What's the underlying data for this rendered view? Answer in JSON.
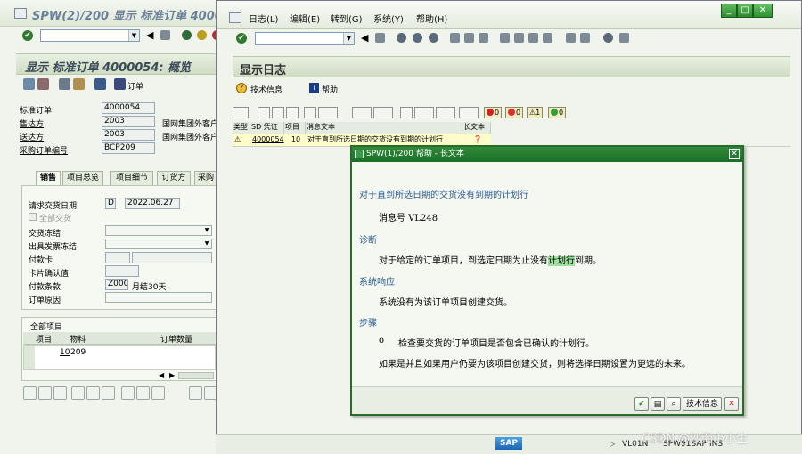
{
  "back_window": {
    "title": "SPW(2)/200 显示 标准订单 4000",
    "header_title": "显示 标准订单 4000054: 概览",
    "toolbar_order_label": "订单",
    "fields": [
      {
        "label": "标准订单",
        "value": "4000054",
        "extra": ""
      },
      {
        "label": "售达方",
        "value": "2003",
        "extra": "国网集团外客户"
      },
      {
        "label": "送达方",
        "value": "2003",
        "extra": "国网集团外客户"
      },
      {
        "label": "采购订单编号",
        "value": "BCP209",
        "extra": ""
      }
    ],
    "tabs": [
      "销售",
      "项目总览",
      "项目细节",
      "订货方",
      "采购"
    ],
    "sales": {
      "req_date_label": "请求交货日期",
      "req_date_unit": "D",
      "req_date_value": "2022.06.27",
      "complete_delivery_label": "全部交货",
      "delivery_block_label": "交货冻结",
      "billing_block_label": "出具发票冻结",
      "payment_card_label": "付款卡",
      "card_verif_label": "卡片确认值",
      "payment_terms_label": "付款条款",
      "payment_terms_code": "Z000",
      "payment_terms_text": "月结30天",
      "order_reason_label": "订单原因"
    },
    "items": {
      "section_label": "全部项目",
      "col_item": "项目",
      "col_material": "物料",
      "col_qty": "订单数量",
      "rows": [
        {
          "item": "10",
          "material": "209"
        }
      ]
    }
  },
  "front_window": {
    "menu": [
      "日志(L)",
      "编辑(E)",
      "转到(G)",
      "系统(Y)",
      "帮助(H)"
    ],
    "header_title": "显示日志",
    "app_toolbar": {
      "tech_info": "技术信息",
      "help": "帮助"
    },
    "counters": [
      "0",
      "0",
      "1",
      "0"
    ],
    "columns": [
      "类型",
      "SD 凭证",
      "项目",
      "消息文本",
      "长文本"
    ],
    "row": {
      "doc": "4000054",
      "item": "10",
      "message": "对于直到所选日期的交货没有到期的计划行"
    }
  },
  "popup": {
    "title": "SPW(1)/200 帮助 - 长文本",
    "heading": "对于直到所选日期的交货没有到期的计划行",
    "message_no": "消息号 VL248",
    "diagnosis_title": "诊断",
    "diagnosis_before": "对于给定的订单项目，到选定日期为止没有",
    "diagnosis_highlight": "计划行",
    "diagnosis_after": "到期。",
    "response_title": "系统响应",
    "response_text": "系统没有为该订单项目创建交货。",
    "steps_title": "步骤",
    "step_bullet": "o",
    "step_1": "检查要交货的订单项目是否包含已确认的计划行。",
    "step_2": "如果是并且如果用户仍要为该项目创建交货，则将选择日期设置为更远的未来。",
    "tech_info_button": "技术信息"
  },
  "statusbar": {
    "logo": "SAP",
    "tcode": "VL01N",
    "system": "SPW91SAP",
    "mode": "INS"
  },
  "watermark": "CSDN @沙海小小生",
  "colors": {
    "sap_green": "#2f8a3a",
    "hint_blue": "#2a5a90",
    "highlight": "#9ee09e"
  }
}
